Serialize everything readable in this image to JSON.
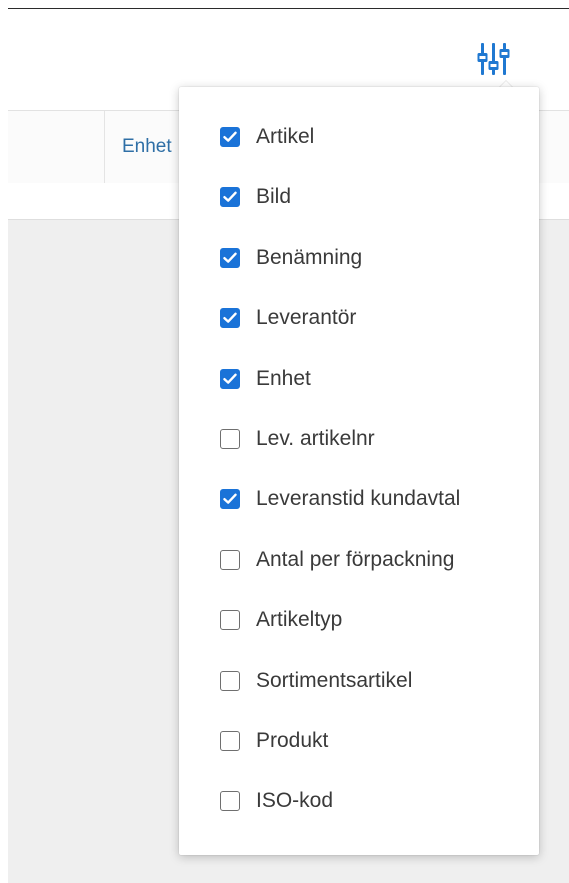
{
  "toolbar": {
    "column_settings_icon": "sliders-icon",
    "accent_color": "#1a73d8"
  },
  "grid": {
    "visible_column_header": "Enhet"
  },
  "column_chooser": {
    "options": [
      {
        "label": "Artikel",
        "checked": true
      },
      {
        "label": "Bild",
        "checked": true
      },
      {
        "label": "Benämning",
        "checked": true
      },
      {
        "label": "Leverantör",
        "checked": true
      },
      {
        "label": "Enhet",
        "checked": true
      },
      {
        "label": "Lev. artikelnr",
        "checked": false
      },
      {
        "label": "Leveranstid kundavtal",
        "checked": true
      },
      {
        "label": "Antal per förpackning",
        "checked": false
      },
      {
        "label": "Artikeltyp",
        "checked": false
      },
      {
        "label": "Sortimentsartikel",
        "checked": false
      },
      {
        "label": "Produkt",
        "checked": false
      },
      {
        "label": "ISO-kod",
        "checked": false
      }
    ]
  }
}
